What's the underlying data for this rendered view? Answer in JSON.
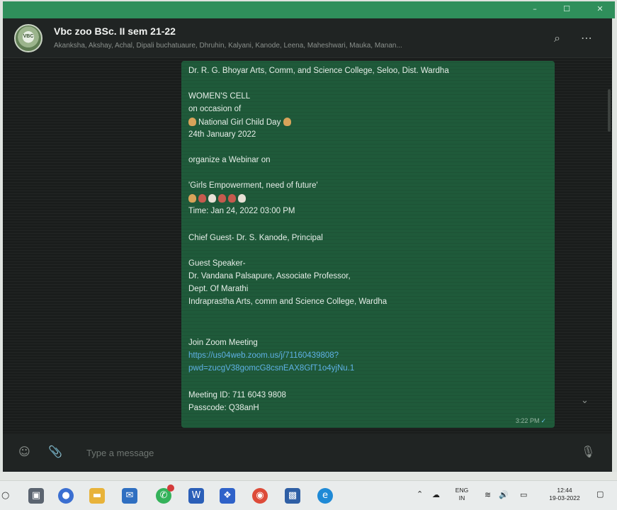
{
  "window": {
    "minimize": "–",
    "maximize": "☐",
    "close": "✕"
  },
  "chat": {
    "name": "Vbc zoo BSc. II sem 21-22",
    "members": "Akanksha, Akshay, Achal, Dipali buchatuaure, Dhruhin, Kalyani, Kanode, Leena, Maheshwari, Mauka, Manan...",
    "avatar_text": "VBC"
  },
  "message": {
    "lines": [
      "Dr. R. G. Bhoyar Arts, Comm, and Science College, Seloo, Dist. Wardha",
      "WOMEN'S CELL",
      "on occasion of",
      "National Girl Child Day",
      "24th January 2022",
      "organize a Webinar on",
      "'Girls Empowerment, need of future'",
      "Time: Jan 24, 2022 03:00 PM",
      "Chief Guest- Dr. S. Kanode, Principal",
      "Guest Speaker-",
      "Dr. Vandana Palsapure, Associate Professor,",
      "Dept. Of Marathi",
      "Indraprastha Arts, comm and Science College, Wardha",
      "Join Zoom Meeting",
      "https://us04web.zoom.us/j/71160439808?",
      "pwd=zucgV38gomcG8csnEAX8GfT1o4yjNu.1",
      "Meeting ID: 711 6043 9808",
      "Passcode: Q38anH"
    ],
    "time": "3:22 PM",
    "tick": "✓"
  },
  "composer": {
    "placeholder": "Type a message",
    "emoji_icon": "☺",
    "attach_icon": "📎",
    "mic_icon": "🎙"
  },
  "header_icons": {
    "search": "⌕",
    "more": "⋯"
  },
  "taskbar": {
    "lang_top": "ENG",
    "lang_bottom": "IN",
    "time": "12:44",
    "date": "19-03-2022"
  }
}
